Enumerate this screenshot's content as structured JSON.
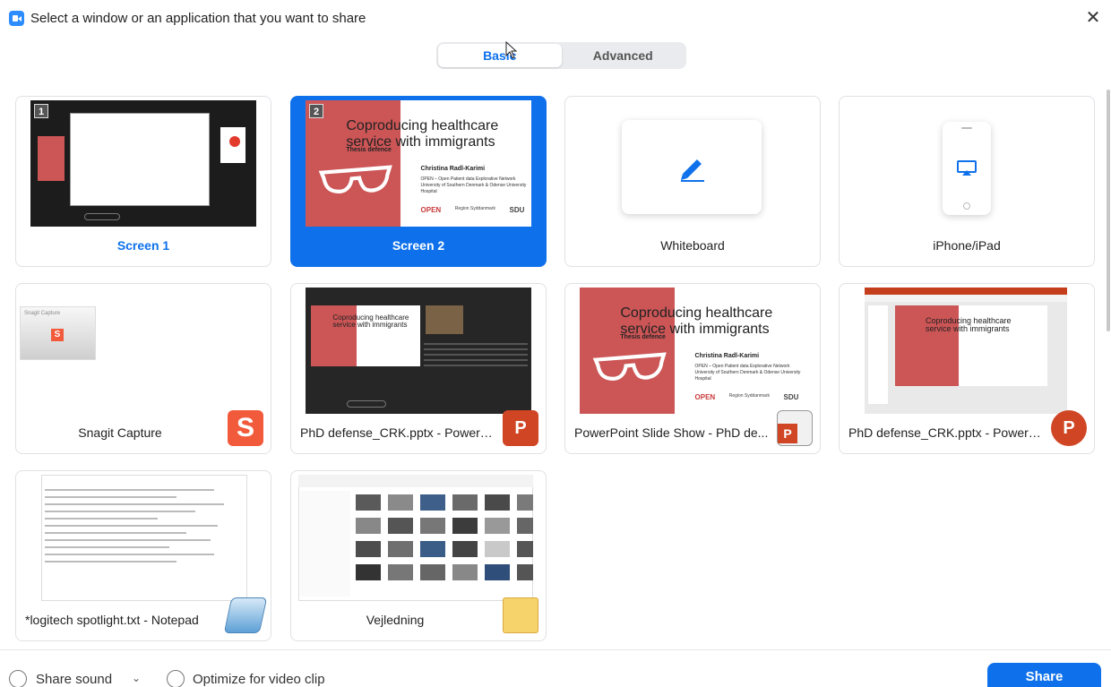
{
  "window": {
    "title": "Select a window or an application that you want to share",
    "close_glyph": "✕"
  },
  "tabs": [
    {
      "label": "Basic",
      "active": true
    },
    {
      "label": "Advanced",
      "active": false
    }
  ],
  "tiles": [
    {
      "label": "Screen 1",
      "number": "1",
      "selected": false
    },
    {
      "label": "Screen 2",
      "number": "2",
      "selected": true
    },
    {
      "label": "Whiteboard",
      "selected": false
    },
    {
      "label": "iPhone/iPad",
      "selected": false
    },
    {
      "label": "Snagit Capture",
      "selected": false,
      "app_icon": "snagit-icon",
      "app_glyph": "S"
    },
    {
      "label": "PhD defense_CRK.pptx - PowerPo...",
      "selected": false,
      "app_icon": "powerpoint-icon",
      "app_glyph": "P"
    },
    {
      "label": "PowerPoint Slide Show -  PhD de...",
      "selected": false,
      "app_icon": "powerpoint-show-icon"
    },
    {
      "label": "PhD defense_CRK.pptx - PowerPo...",
      "selected": false,
      "app_icon": "powerpoint-icon",
      "app_glyph": "P"
    },
    {
      "label": "*logitech spotlight.txt - Notepad",
      "selected": false,
      "app_icon": "notepad-icon"
    },
    {
      "label": "Vejledning",
      "selected": false,
      "app_icon": "folder-icon"
    }
  ],
  "slide": {
    "title_line1": "Coproducing healthcare",
    "title_line2": "service with immigrants",
    "subtitle": "Thesis defence",
    "author": "Christina Radl-Karimi",
    "affiliation_line1": "OPEN – Open Patient data Explorative Network",
    "affiliation_line2": "University of Southern Denmark & Odense University Hospital",
    "logo1": "OPEN",
    "logo2": "Region Syddanmark",
    "logo3": "SDU"
  },
  "snagit_thumb_text": "Snagit Capture",
  "bottom": {
    "share_sound_label": "Share sound",
    "optimize_label": "Optimize for video clip",
    "share_button": "Share"
  },
  "colors": {
    "accent": "#0e71eb",
    "slide_red": "#cc5556"
  }
}
